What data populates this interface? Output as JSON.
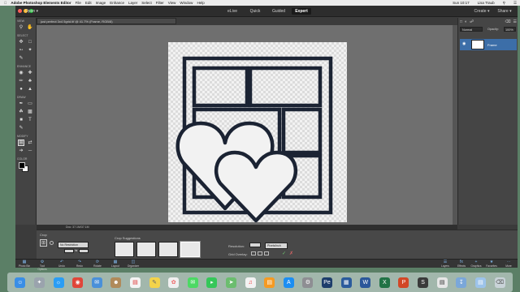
{
  "menubar": {
    "items": [
      "Adobe Photoshop Elements Editor",
      "File",
      "Edit",
      "Image",
      "Enhance",
      "Layer",
      "Select",
      "Filter",
      "View",
      "Window",
      "Help"
    ],
    "clock": "Sun 10:17",
    "user": "Lisa Traub"
  },
  "topbar": {
    "open_label": "Open",
    "modes": [
      "eLive",
      "Quick",
      "Guided",
      "Expert"
    ],
    "active_mode": "Expert",
    "create_label": "Create",
    "share_label": "Share"
  },
  "document": {
    "tab_title": "just perfect 3x4 5grid.tif @ 41.7% (Frame, RGB/8)",
    "status": "Doc: 37.1M/37.1M"
  },
  "tools": {
    "sections": [
      "VIEW",
      "SELECT",
      "ENHANCE",
      "DRAW",
      "MODIFY",
      "COLOR"
    ]
  },
  "layers": {
    "blend_mode": "Normal",
    "opacity_label": "Opacity:",
    "opacity_value": "100%",
    "layer_name": "Frame"
  },
  "options": {
    "title": "Crop",
    "preset": "No Restriction",
    "suggestions_label": "Crop Suggestions",
    "resolution_label": "Resolution:",
    "resolution_unit": "Pixels/inch",
    "grid_overlay_label": "Grid Overlay:"
  },
  "bottombar": {
    "left": [
      "Photo Bin",
      "Tool Options",
      "Undo",
      "Redo",
      "Rotate",
      "Layout",
      "Organizer"
    ],
    "right": [
      "Layers",
      "Effects",
      "Graphics",
      "Favorites",
      "More"
    ]
  },
  "colors": {
    "frame_stroke": "#1b2333",
    "accent": "#3c6ea8",
    "active_mode_bg": "#1a1a1a"
  }
}
